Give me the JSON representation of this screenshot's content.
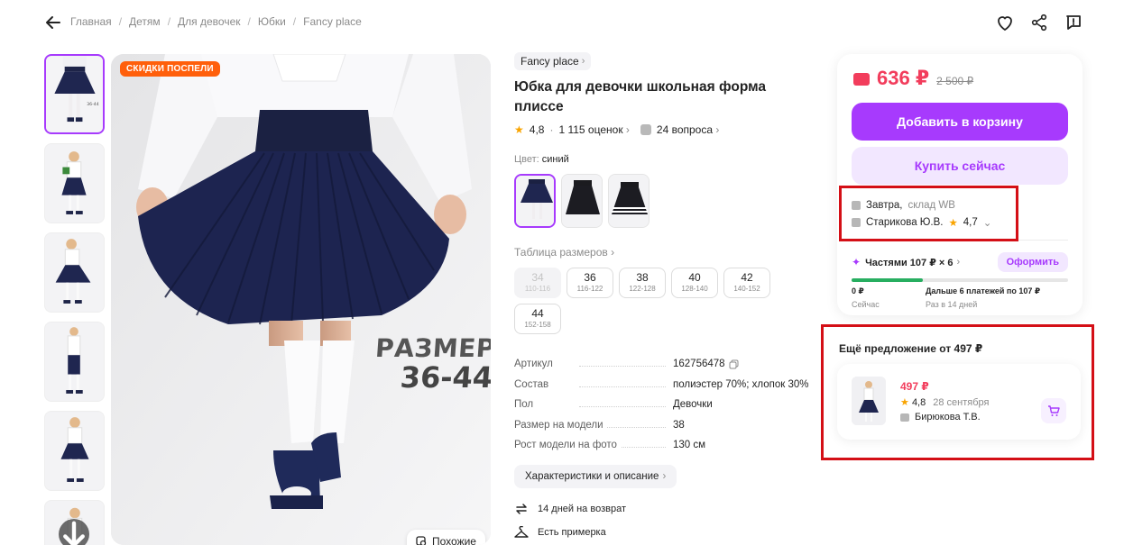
{
  "breadcrumbs": [
    "Главная",
    "Детям",
    "Для девочек",
    "Юбки",
    "Fancy place"
  ],
  "main_photo": {
    "sale_badge": "СКИДКИ ПОСПЕЛИ",
    "stamp_line1": "РАЗМЕРЫ",
    "stamp_line2": "36-44",
    "similar_label": "Похожие"
  },
  "product": {
    "brand": "Fancy place",
    "title": "Юбка для девочки школьная форма плиссе",
    "rating": "4,8",
    "ratings_count": "1 115 оценок",
    "questions": "24 вопроса",
    "color_label": "Цвет:",
    "color_value": "синий",
    "size_table_label": "Таблица размеров",
    "sizes": [
      {
        "n": "34",
        "r": "110-116"
      },
      {
        "n": "36",
        "r": "116-122"
      },
      {
        "n": "38",
        "r": "122-128"
      },
      {
        "n": "40",
        "r": "128-140"
      },
      {
        "n": "42",
        "r": "140-152"
      },
      {
        "n": "44",
        "r": "152-158"
      }
    ],
    "specs": [
      {
        "k": "Артикул",
        "v": "162756478"
      },
      {
        "k": "Состав",
        "v": "полиэстер 70%; хлопок 30%"
      },
      {
        "k": "Пол",
        "v": "Девочки"
      },
      {
        "k": "Размер на модели",
        "v": "38"
      },
      {
        "k": "Рост модели на фото",
        "v": "130 см"
      }
    ],
    "chars_button": "Характеристики и описание",
    "features": [
      "14 дней на возврат",
      "Есть примерка"
    ]
  },
  "buy": {
    "price": "636 ₽",
    "old_price": "2 500 ₽",
    "add_to_cart": "Добавить в корзину",
    "buy_now": "Купить сейчас",
    "delivery_day": "Завтра,",
    "delivery_warehouse": "склад WB",
    "seller": "Старикова Ю.В.",
    "seller_rating": "4,7",
    "installment_label": "Частями 107 ₽ × 6",
    "installment_button": "Оформить",
    "installment_progress": 0.33,
    "now_amount": "0 ₽",
    "now_label": "Сейчас",
    "later_amount": "Дальше 6 платежей по 107 ₽",
    "later_label": "Раз в 14 дней"
  },
  "other_offer": {
    "title": "Ещё предложение от 497 ₽",
    "price": "497 ₽",
    "rating": "4,8",
    "date": "28 сентября",
    "seller": "Бирюкова Т.В."
  },
  "colors": {
    "accent": "#a73afd",
    "price": "#f23d5c",
    "sale": "#ff5f0b",
    "highlight": "#d40f16"
  }
}
